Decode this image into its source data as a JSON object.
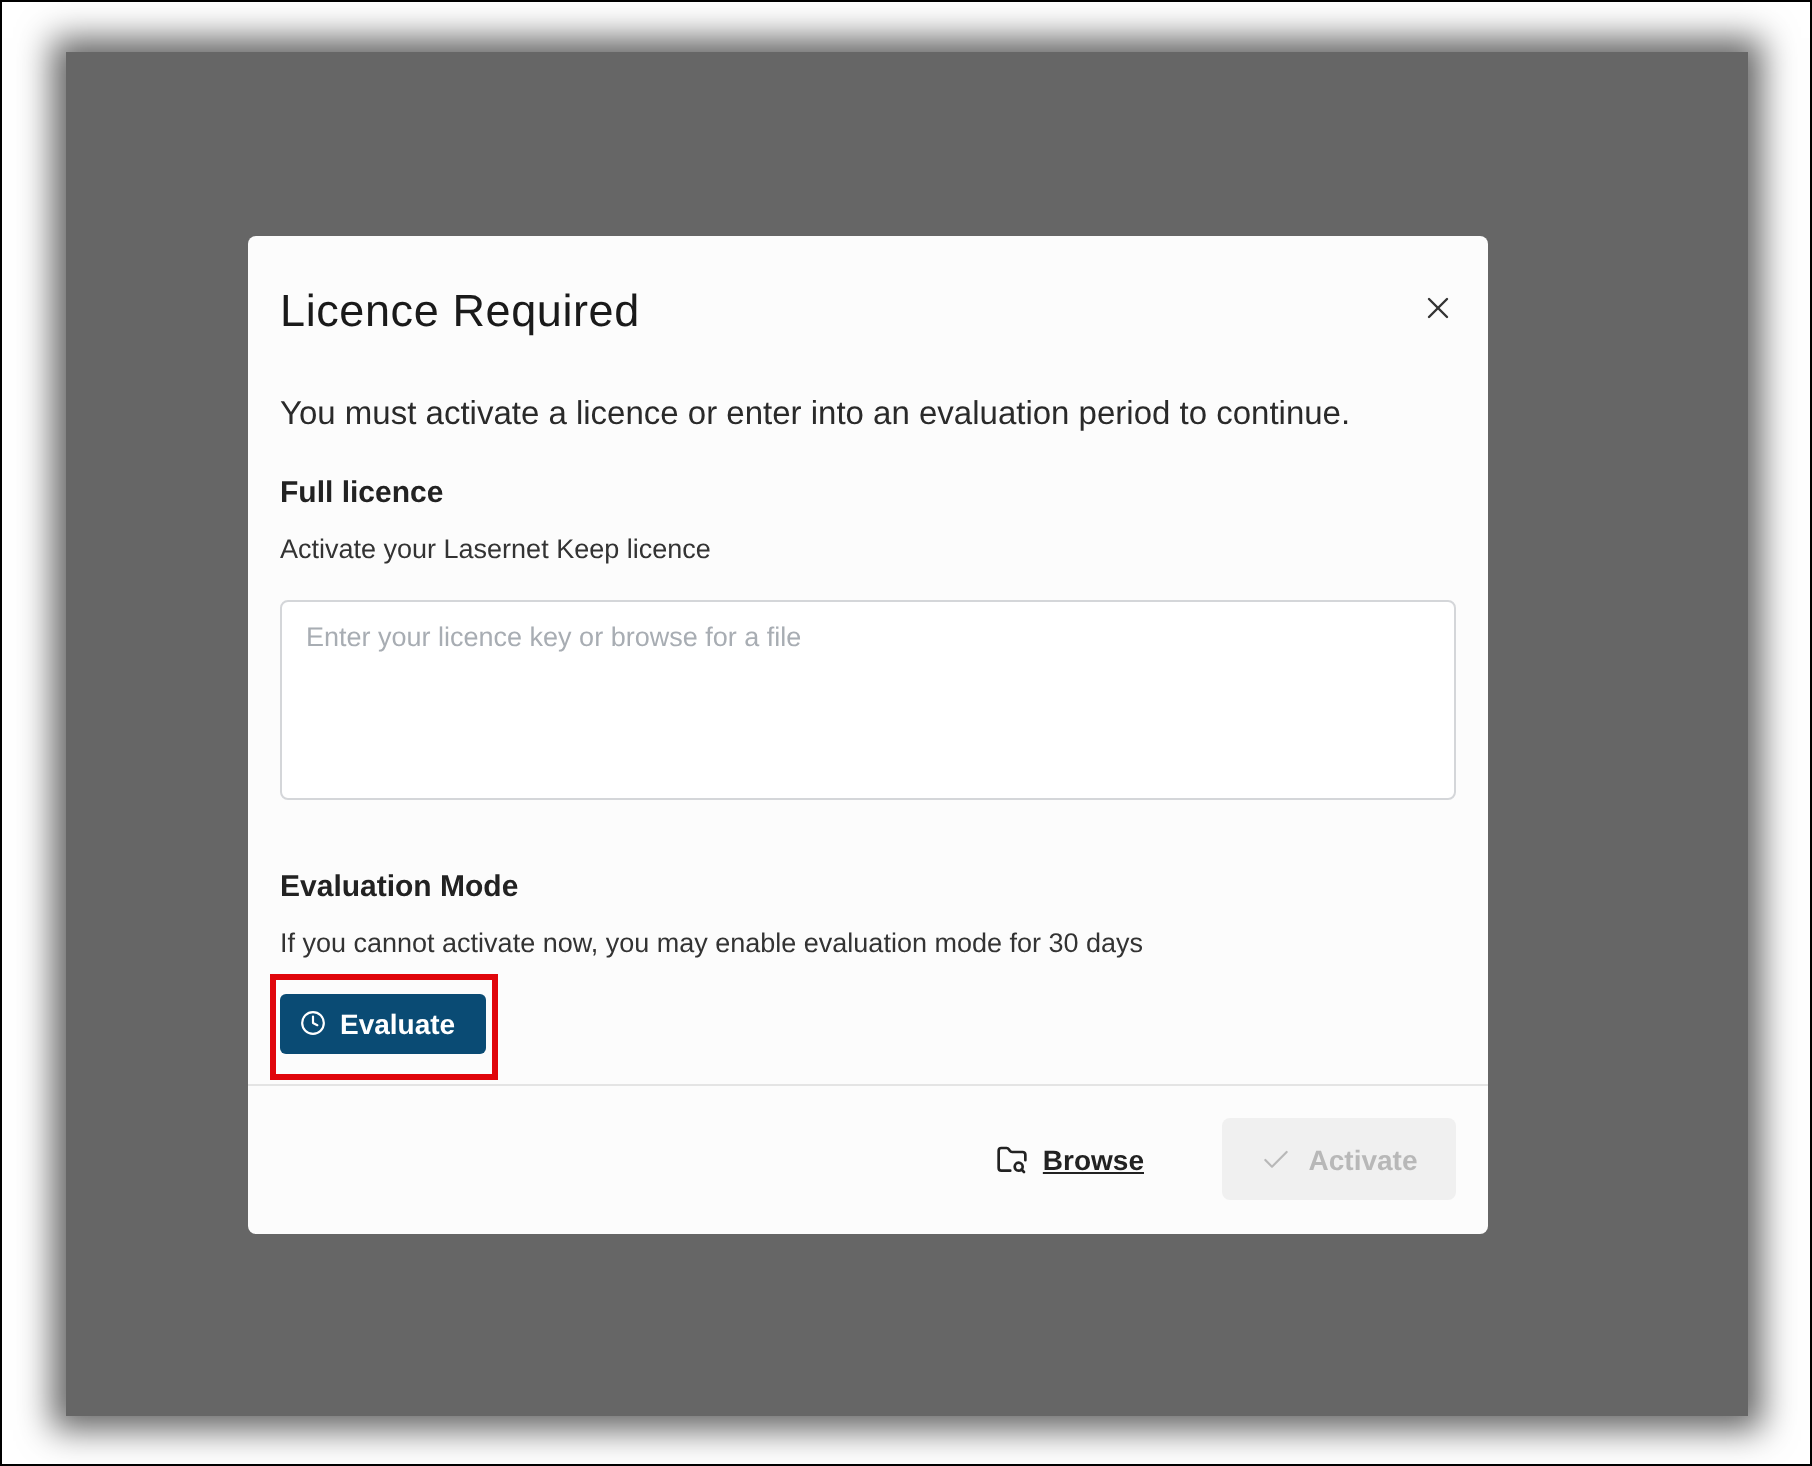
{
  "dialog": {
    "title": "Licence Required",
    "message": "You must activate a licence or enter into an evaluation period to continue.",
    "full_licence": {
      "heading": "Full licence",
      "description": "Activate your Lasernet Keep licence",
      "licence_field": {
        "placeholder": "Enter your licence key or browse for a file"
      }
    },
    "evaluation": {
      "heading": "Evaluation Mode",
      "description": "If you cannot activate now, you may enable evaluation mode for 30 days",
      "evaluate_button": {
        "label": "Evaluate",
        "highlighted": true
      }
    },
    "footer": {
      "browse_link": {
        "label": "Browse"
      },
      "activate_button": {
        "label": "Activate",
        "disabled": true
      }
    }
  }
}
